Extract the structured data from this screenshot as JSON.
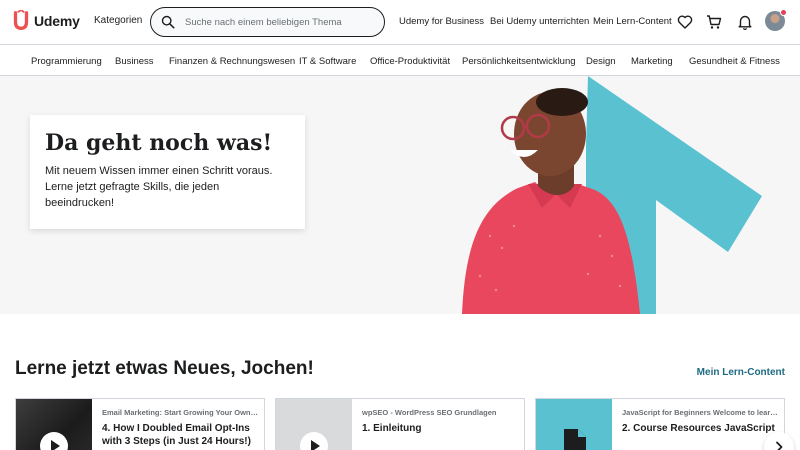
{
  "header": {
    "logo_text": "Udemy",
    "categories_label": "Kategorien",
    "search_placeholder": "Suche nach einem beliebigen Thema",
    "links": {
      "business": "Udemy for Business",
      "teach": "Bei Udemy unterrichten",
      "my_learning": "Mein Lern-Content"
    },
    "icons": [
      "heart-icon",
      "cart-icon",
      "bell-icon"
    ],
    "notification_dot_color": "#e23f59"
  },
  "categories": [
    "Programmierung",
    "Business",
    "Finanzen & Rechnungswesen",
    "IT & Software",
    "Office-Produktivität",
    "Persönlichkeitsentwicklung",
    "Design",
    "Marketing",
    "Gesundheit & Fitness"
  ],
  "hero": {
    "title": "Da geht noch was!",
    "text": "Mit neuem Wissen immer einen Schritt voraus. Lerne jetzt gefragte Skills, die jeden beeindrucken!"
  },
  "section": {
    "title": "Lerne jetzt etwas Neues, Jochen!",
    "link": "Mein Lern-Content"
  },
  "cards": [
    {
      "course": "Email Marketing: Start Growing Your Own Em...",
      "lecture": "4. How I Doubled Email Opt-Ins with 3 Steps (in Just 24 Hours!)"
    },
    {
      "course": "wpSEO - WordPress SEO Grundlagen",
      "lecture": "1. Einleitung"
    },
    {
      "course": "JavaScript for Beginners Welcome to learnin...",
      "lecture": "2. Course Resources JavaScript"
    }
  ],
  "colors": {
    "brand": "#a435f0",
    "logo_red": "#ec5252",
    "link_teal": "#1e6b83",
    "hero_teal": "#5ac1d0",
    "shirt_pink": "#e8475d"
  }
}
